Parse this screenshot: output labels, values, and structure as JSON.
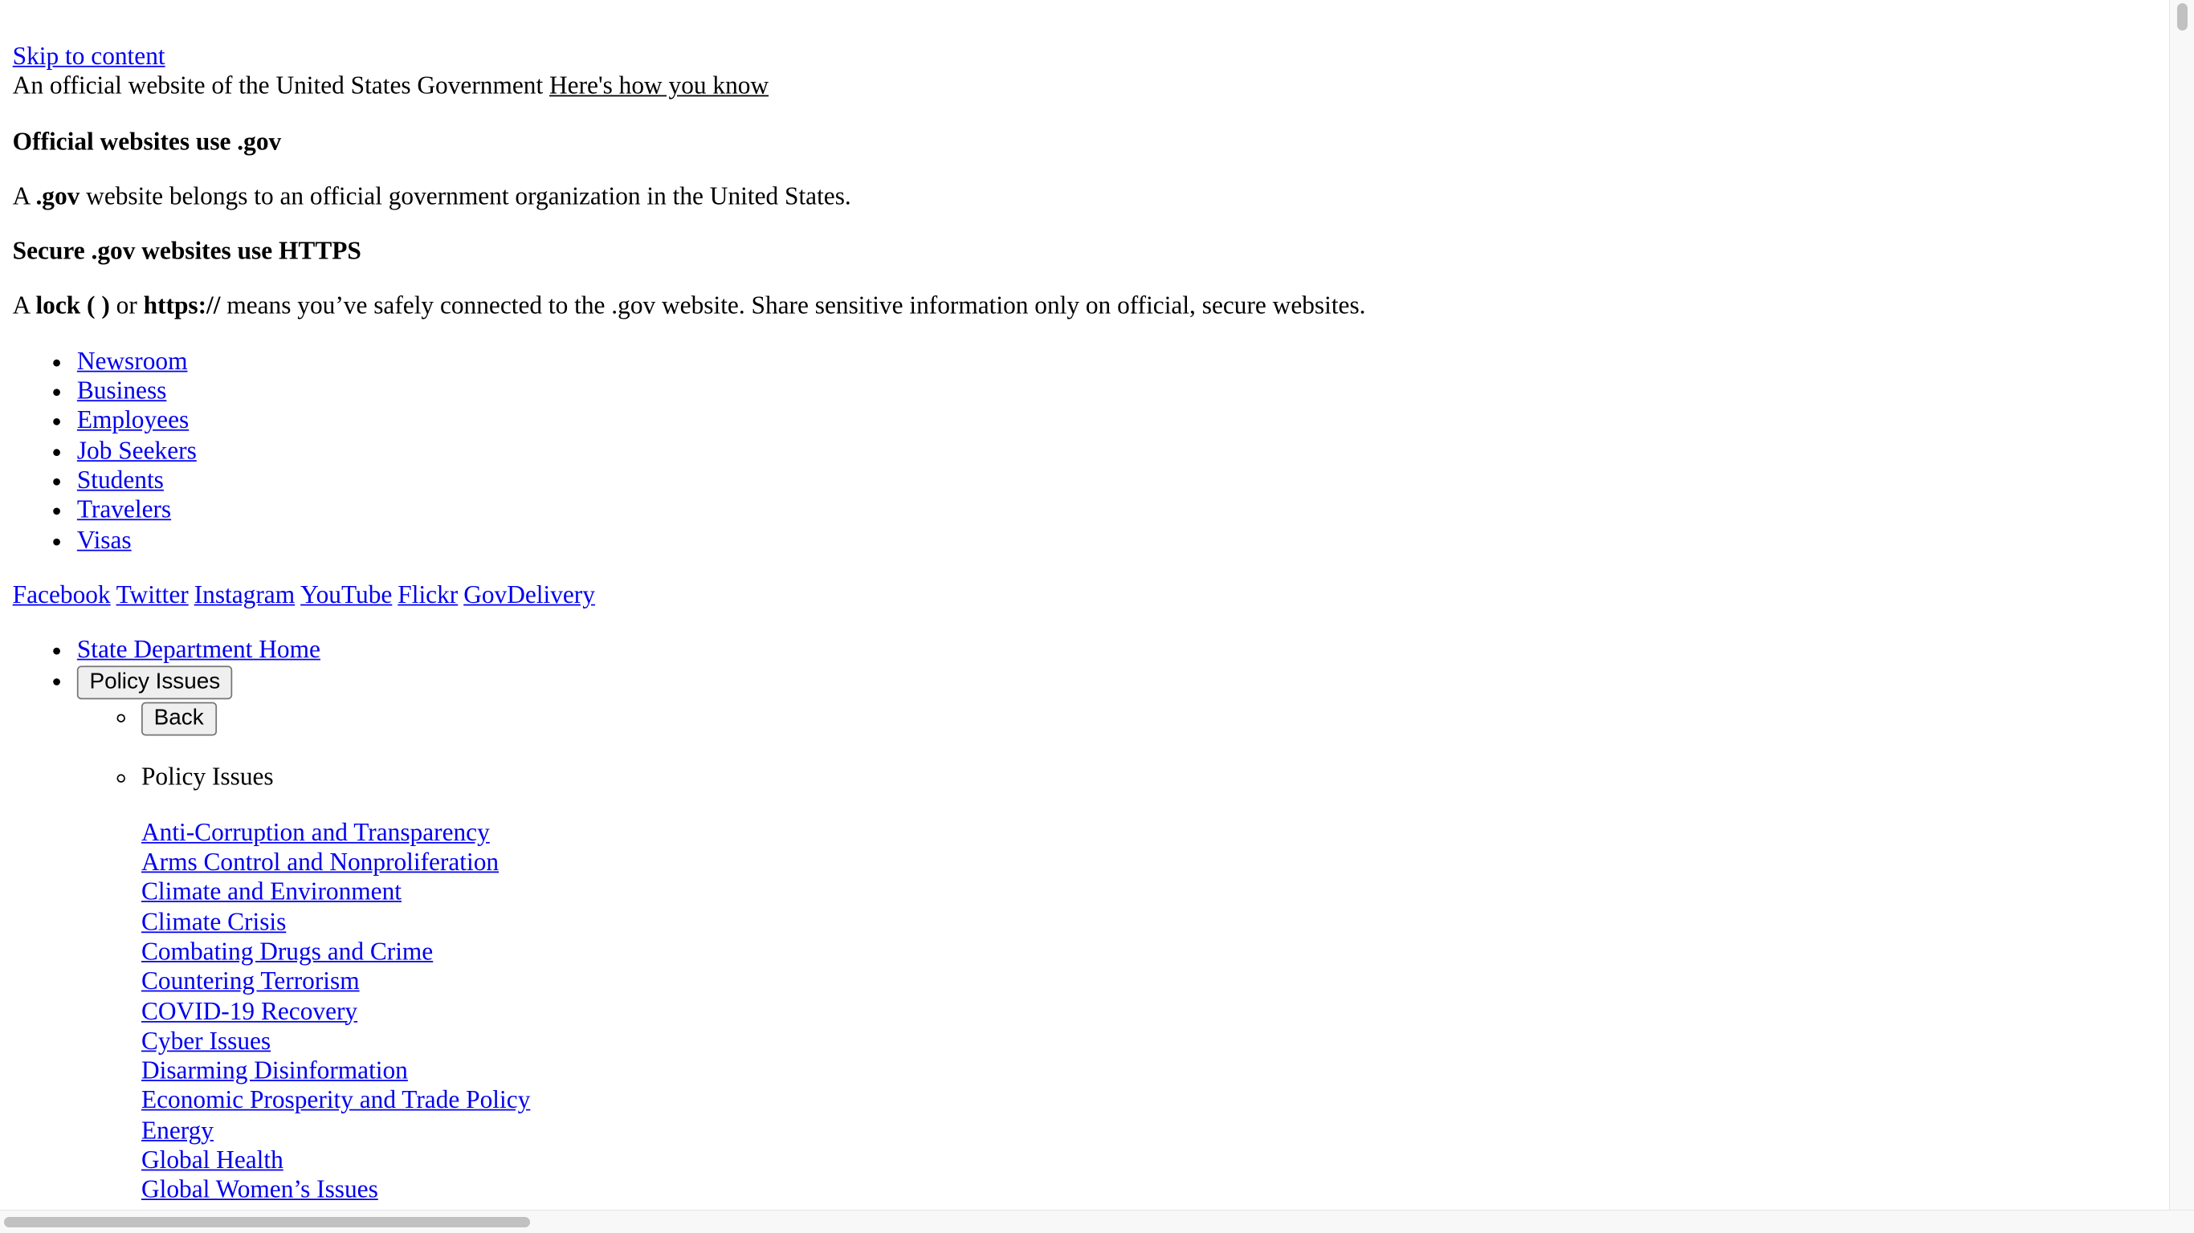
{
  "skip_link": "Skip to content",
  "banner": {
    "official_text": "An official website of the United States Government",
    "how_you_know": "Here's how you know",
    "gov_heading": "Official websites use .gov",
    "gov_p_start": "A",
    "gov_p_bold": ".gov",
    "gov_p_end": "website belongs to an official government organization in the United States.",
    "https_heading": "Secure .gov websites use HTTPS",
    "https_p_a": "A",
    "https_p_lock": "lock ( )",
    "https_p_or": "or",
    "https_p_https": "https://",
    "https_p_end": "means you’ve safely connected to the .gov website. Share sensitive information only on official, secure websites."
  },
  "audience_nav": [
    "Newsroom",
    "Business",
    "Employees",
    "Job Seekers",
    "Students",
    "Travelers",
    "Visas"
  ],
  "social": [
    "Facebook",
    "Twitter",
    "Instagram",
    "YouTube",
    "Flickr",
    "GovDelivery"
  ],
  "main_nav": {
    "home": "State Department Home",
    "policy_button": "Policy Issues",
    "back_button": "Back",
    "submenu_heading": "Policy Issues",
    "submenu_links": [
      "Anti-Corruption and Transparency",
      "Arms Control and Nonproliferation",
      "Climate and Environment",
      "Climate Crisis",
      "Combating Drugs and Crime",
      "Countering Terrorism",
      "COVID-19 Recovery",
      "Cyber Issues",
      "Disarming Disinformation",
      "Economic Prosperity and Trade Policy",
      "Energy",
      "Global Health",
      "Global Women’s Issues"
    ]
  }
}
